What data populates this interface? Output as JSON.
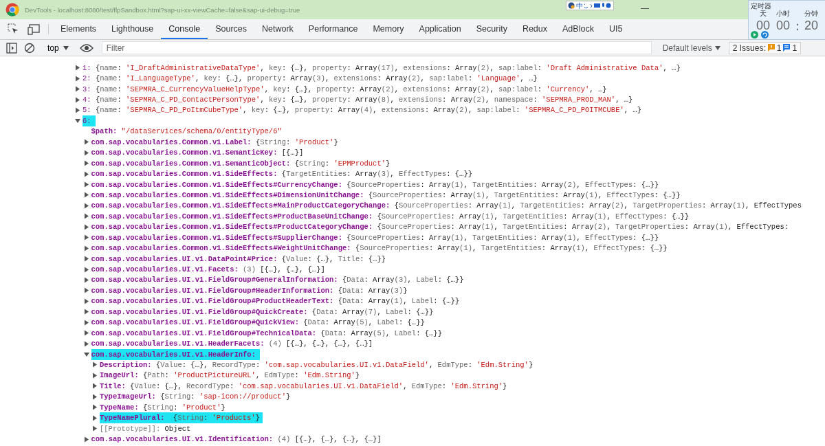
{
  "window": {
    "title": "DevTools - localhost:8080/test/flpSandbox.html?sap-ui-xx-viewCache=false&sap-ui-debug=true"
  },
  "ime_toolbar": {
    "label": "中"
  },
  "tabs": [
    {
      "label": "Elements",
      "selected": false
    },
    {
      "label": "Lighthouse",
      "selected": false
    },
    {
      "label": "Console",
      "selected": true
    },
    {
      "label": "Sources",
      "selected": false
    },
    {
      "label": "Network",
      "selected": false
    },
    {
      "label": "Performance",
      "selected": false
    },
    {
      "label": "Memory",
      "selected": false
    },
    {
      "label": "Application",
      "selected": false
    },
    {
      "label": "Security",
      "selected": false
    },
    {
      "label": "Redux",
      "selected": false
    },
    {
      "label": "AdBlock",
      "selected": false
    },
    {
      "label": "UI5",
      "selected": false
    }
  ],
  "console_toolbar": {
    "context": "top",
    "filter": {
      "placeholder": "Filter"
    },
    "levels": "Default levels",
    "issues": {
      "label": "2 Issues:",
      "warnings": "1",
      "infos": "1"
    }
  },
  "timer": {
    "title": "定时器",
    "units": [
      "天",
      "小时",
      "分钟"
    ],
    "values": [
      "00",
      "00",
      "20"
    ],
    "separator": ":"
  },
  "lines": [
    {
      "kind": "index",
      "key": "1:",
      "value": "{name: 'I_DraftAdministrativeDataType', key: {…}, property: Array(17), extensions: Array(2), sap:label: 'Draft Administrative Data', …}",
      "expanded": false,
      "highlighted": false
    },
    {
      "kind": "index",
      "key": "2:",
      "value": "{name: 'I_LanguageType', key: {…}, property: Array(3), extensions: Array(2), sap:label: 'Language', …}",
      "expanded": false,
      "highlighted": false
    },
    {
      "kind": "index",
      "key": "3:",
      "value": "{name: 'SEPMRA_C_CurrencyValueHelpType', key: {…}, property: Array(2), extensions: Array(2), sap:label: 'Currency', …}",
      "expanded": false,
      "highlighted": false
    },
    {
      "kind": "index",
      "key": "4:",
      "value": "{name: 'SEPMRA_C_PD_ContactPersonType', key: {…}, property: Array(8), extensions: Array(2), namespace: 'SEPMRA_PROD_MAN', …}",
      "expanded": false,
      "highlighted": false
    },
    {
      "kind": "index",
      "key": "5:",
      "value": "{name: 'SEPMRA_C_PD_PoItmCubeType', key: {…}, property: Array(4), extensions: Array(2), sap:label: 'SEPMRA_C_PD_POITMCUBE', …}",
      "expanded": false,
      "highlighted": false
    },
    {
      "kind": "index",
      "key": "6:",
      "expanded": true,
      "highlighted": true,
      "children": [
        {
          "kind": "property",
          "key": "$path:",
          "value": "\"/dataServices/schema/0/entityType/6\"",
          "highlighted": false
        },
        {
          "kind": "property",
          "key": "com.sap.vocabularies.Common.v1.Label:",
          "value": "{String: 'Product'}",
          "expanded": false,
          "highlighted": false
        },
        {
          "kind": "property",
          "key": "com.sap.vocabularies.Common.v1.SemanticKey:",
          "value": "[{…}]",
          "expanded": false,
          "highlighted": false
        },
        {
          "kind": "property",
          "key": "com.sap.vocabularies.Common.v1.SemanticObject:",
          "value": "{String: 'EPMProduct'}",
          "expanded": false,
          "highlighted": false
        },
        {
          "kind": "property",
          "key": "com.sap.vocabularies.Common.v1.SideEffects:",
          "value": "{TargetEntities: Array(3), EffectTypes: {…}}",
          "expanded": false,
          "highlighted": false
        },
        {
          "kind": "property",
          "key": "com.sap.vocabularies.Common.v1.SideEffects#CurrencyChange:",
          "value": "{SourceProperties: Array(1), TargetEntities: Array(2), EffectTypes: {…}}",
          "expanded": false,
          "highlighted": false
        },
        {
          "kind": "property",
          "key": "com.sap.vocabularies.Common.v1.SideEffects#DimensionUnitChange:",
          "value": "{SourceProperties: Array(1), TargetEntities: Array(1), EffectTypes: {…}}",
          "expanded": false,
          "highlighted": false
        },
        {
          "kind": "property",
          "key": "com.sap.vocabularies.Common.v1.SideEffects#MainProductCategoryChange:",
          "value": "{SourceProperties: Array(1), TargetEntities: Array(2), TargetProperties: Array(1), EffectTypes",
          "expanded": false,
          "highlighted": false
        },
        {
          "kind": "property",
          "key": "com.sap.vocabularies.Common.v1.SideEffects#ProductBaseUnitChange:",
          "value": "{SourceProperties: Array(1), TargetEntities: Array(1), EffectTypes: {…}}",
          "expanded": false,
          "highlighted": false
        },
        {
          "kind": "property",
          "key": "com.sap.vocabularies.Common.v1.SideEffects#ProductCategoryChange:",
          "value": "{SourceProperties: Array(1), TargetEntities: Array(2), TargetProperties: Array(1), EffectTypes:",
          "expanded": false,
          "highlighted": false
        },
        {
          "kind": "property",
          "key": "com.sap.vocabularies.Common.v1.SideEffects#SupplierChange:",
          "value": "{SourceProperties: Array(1), TargetEntities: Array(1), EffectTypes: {…}}",
          "expanded": false,
          "highlighted": false
        },
        {
          "kind": "property",
          "key": "com.sap.vocabularies.Common.v1.SideEffects#WeightUnitChange:",
          "value": "{SourceProperties: Array(1), TargetEntities: Array(1), EffectTypes: {…}}",
          "expanded": false,
          "highlighted": false
        },
        {
          "kind": "property",
          "key": "com.sap.vocabularies.UI.v1.DataPoint#Price:",
          "value": "{Value: {…}, Title: {…}}",
          "expanded": false,
          "highlighted": false
        },
        {
          "kind": "property",
          "key": "com.sap.vocabularies.UI.v1.Facets:",
          "value": "(3) [{…}, {…}, {…}]",
          "expanded": false,
          "highlighted": false
        },
        {
          "kind": "property",
          "key": "com.sap.vocabularies.UI.v1.FieldGroup#GeneralInformation:",
          "value": "{Data: Array(3), Label: {…}}",
          "expanded": false,
          "highlighted": false
        },
        {
          "kind": "property",
          "key": "com.sap.vocabularies.UI.v1.FieldGroup#HeaderInformation:",
          "value": "{Data: Array(3)}",
          "expanded": false,
          "highlighted": false
        },
        {
          "kind": "property",
          "key": "com.sap.vocabularies.UI.v1.FieldGroup#ProductHeaderText:",
          "value": "{Data: Array(1), Label: {…}}",
          "expanded": false,
          "highlighted": false
        },
        {
          "kind": "property",
          "key": "com.sap.vocabularies.UI.v1.FieldGroup#QuickCreate:",
          "value": "{Data: Array(7), Label: {…}}",
          "expanded": false,
          "highlighted": false
        },
        {
          "kind": "property",
          "key": "com.sap.vocabularies.UI.v1.FieldGroup#QuickView:",
          "value": "{Data: Array(5), Label: {…}}",
          "expanded": false,
          "highlighted": false
        },
        {
          "kind": "property",
          "key": "com.sap.vocabularies.UI.v1.FieldGroup#TechnicalData:",
          "value": "{Data: Array(5), Label: {…}}",
          "expanded": false,
          "highlighted": false
        },
        {
          "kind": "property",
          "key": "com.sap.vocabularies.UI.v1.HeaderFacets:",
          "value": "(4) [{…}, {…}, {…}, {…}]",
          "expanded": false,
          "highlighted": false
        },
        {
          "kind": "property",
          "key": "com.sap.vocabularies.UI.v1.HeaderInfo:",
          "expanded": true,
          "highlighted": true,
          "children": [
            {
              "kind": "property",
              "key": "Description:",
              "value": "{Value: {…}, RecordType: 'com.sap.vocabularies.UI.v1.DataField', EdmType: 'Edm.String'}",
              "expanded": false,
              "highlighted": false
            },
            {
              "kind": "property",
              "key": "ImageUrl:",
              "value": "{Path: 'ProductPictureURL', EdmType: 'Edm.String'}",
              "expanded": false,
              "highlighted": false
            },
            {
              "kind": "property",
              "key": "Title:",
              "value": "{Value: {…}, RecordType: 'com.sap.vocabularies.UI.v1.DataField', EdmType: 'Edm.String'}",
              "expanded": false,
              "highlighted": false
            },
            {
              "kind": "property",
              "key": "TypeImageUrl:",
              "value": "{String: 'sap-icon://product'}",
              "expanded": false,
              "highlighted": false
            },
            {
              "kind": "property",
              "key": "TypeName:",
              "value": "{String: 'Product'}",
              "expanded": false,
              "highlighted": false
            },
            {
              "kind": "property",
              "key": "TypeNamePlural:",
              "value": "{String: 'Products'}",
              "expanded": false,
              "highlighted": true
            },
            {
              "kind": "internal",
              "key": "[[Prototype]]:",
              "value": "Object",
              "expanded": false,
              "highlighted": false
            }
          ]
        },
        {
          "kind": "property",
          "key": "com.sap.vocabularies.UI.v1.Identification:",
          "value": "(4) [{…}, {…}, {…}, {…}]",
          "expanded": false,
          "highlighted": false
        }
      ]
    }
  ]
}
